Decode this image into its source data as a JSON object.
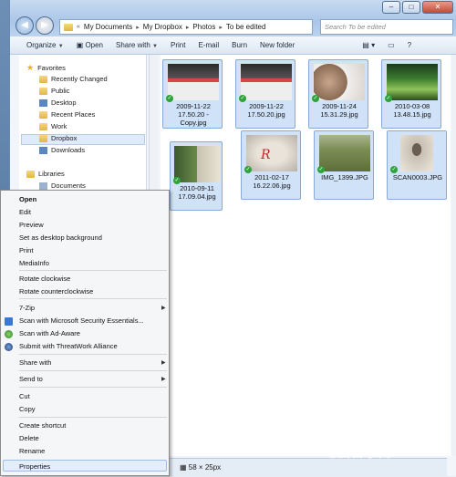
{
  "breadcrumb": [
    "My Documents",
    "My Dropbox",
    "Photos",
    "To be edited"
  ],
  "search": {
    "placeholder": "Search To be edited"
  },
  "toolbar": {
    "organize": "Organize",
    "open": "Open",
    "share_with": "Share with",
    "print": "Print",
    "email": "E-mail",
    "burn": "Burn",
    "new_folder": "New folder"
  },
  "nav": {
    "favorites": "Favorites",
    "items": [
      "Recently Changed",
      "Public",
      "Desktop",
      "Recent Places",
      "Work",
      "Dropbox",
      "Downloads"
    ],
    "libraries": "Libraries",
    "documents": "Documents"
  },
  "files": [
    {
      "l1": "2009-11-22",
      "l2": "17.50.20 -",
      "l3": "Copy.jpg"
    },
    {
      "l1": "2009-11-22",
      "l2": "17.50.20.jpg",
      "l3": ""
    },
    {
      "l1": "2009-11-24",
      "l2": "15.31.29.jpg",
      "l3": ""
    },
    {
      "l1": "2010-03-08",
      "l2": "13.48.15.jpg",
      "l3": ""
    },
    {
      "l1": "2010-09-11",
      "l2": "17.09.04.jpg",
      "l3": ""
    },
    {
      "l1": "2011-02-17",
      "l2": "16.22.06.jpg",
      "l3": ""
    },
    {
      "l1": "IMG_1399.JPG",
      "l2": "",
      "l3": ""
    },
    {
      "l1": "SCAN0003.JPG",
      "l2": "",
      "l3": ""
    }
  ],
  "status": {
    "dimensions": "58 × 25px"
  },
  "watermark": "电脑百事网",
  "menu": {
    "open": "Open",
    "edit": "Edit",
    "preview": "Preview",
    "set_bg": "Set as desktop background",
    "print": "Print",
    "mediainfo": "MediaInfo",
    "rot_cw": "Rotate clockwise",
    "rot_ccw": "Rotate counterclockwise",
    "zip": "7-Zip",
    "scan_mse": "Scan with Microsoft Security Essentials...",
    "scan_adaware": "Scan with Ad-Aware",
    "threatwork": "Submit with ThreatWork Alliance",
    "share_with": "Share with",
    "send_to": "Send to",
    "cut": "Cut",
    "copy": "Copy",
    "create_shortcut": "Create shortcut",
    "delete": "Delete",
    "rename": "Rename",
    "properties": "Properties"
  },
  "colors": {
    "accent": "#83aad8",
    "check": "#2fa33a"
  }
}
